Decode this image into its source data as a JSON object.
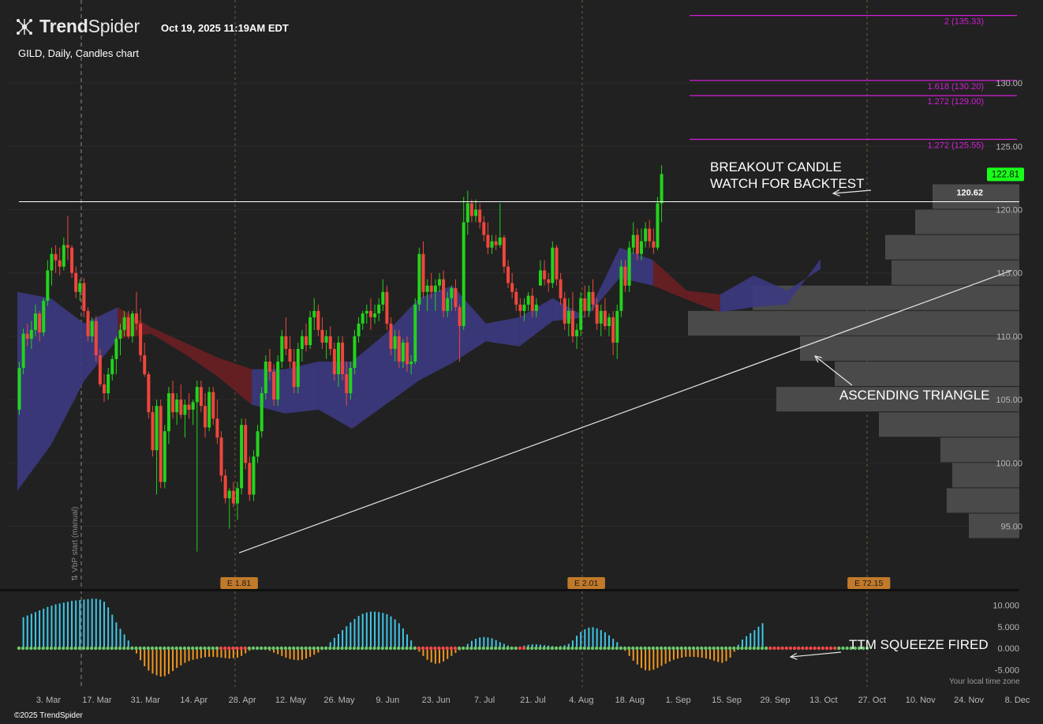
{
  "header": {
    "brand_strong": "Trend",
    "brand_light": "Spider",
    "timestamp": "Oct 19, 2025 11:19AM EDT",
    "subtitle": "GILD, Daily, Candles chart",
    "copyright": "©2025 TrendSpider",
    "timezone_label": "Your local time zone",
    "logo_icon": "trendspider-logo-icon"
  },
  "colors": {
    "background": "#212121",
    "up": "#22d41c",
    "down": "#f0463c",
    "fib": "#d21ed6",
    "cloud_bull": "#3c3a82",
    "cloud_bear": "#6b1f22",
    "vbp": "#4a4a4a",
    "squeeze_pos": "#3ec6e6",
    "squeeze_neg": "#f0961e",
    "price_tag": "#1aff1a",
    "earnings": "#c07a2a"
  },
  "chart_data": {
    "type": "candlestick",
    "symbol": "GILD",
    "timeframe": "Daily",
    "x_tick_labels": [
      "3. Mar",
      "17. Mar",
      "31. Mar",
      "14. Apr",
      "28. Apr",
      "12. May",
      "26. May",
      "9. Jun",
      "23. Jun",
      "7. Jul",
      "21. Jul",
      "4. Aug",
      "18. Aug",
      "1. Sep",
      "15. Sep",
      "29. Sep",
      "13. Oct",
      "27. Oct",
      "10. Nov",
      "24. Nov",
      "8. Dec"
    ],
    "y_axis": {
      "min": 91,
      "max": 137,
      "ticks": [
        "95.00",
        "100.00",
        "105.00",
        "110.00",
        "115.00",
        "120.00",
        "125.00",
        "130.00"
      ]
    },
    "last_price": {
      "value": 122.81,
      "label": "122.81"
    },
    "horizontal_line": {
      "value": 120.62,
      "label": "120.62"
    },
    "fib_levels": [
      {
        "value": 135.33,
        "label": "2 (135.33)"
      },
      {
        "value": 130.2,
        "label": "1.618 (130.20)"
      },
      {
        "value": 129.0,
        "label": "1.272 (129.00)"
      },
      {
        "value": 125.55,
        "label": "1.272 (125.55)"
      }
    ],
    "trendline": {
      "start": {
        "date": "2025-04-28",
        "value": 92.9
      },
      "end": {
        "date": "2025-12-11",
        "value": 115.2
      }
    },
    "earnings": [
      {
        "date": "2025-04-28",
        "label": "E 1.81"
      },
      {
        "date": "2025-08-08",
        "label": "E 2.01"
      },
      {
        "date": "2025-10-30",
        "label": "E 72.15"
      }
    ],
    "vbp_start_label": "VbP start (manual)",
    "annotations": [
      {
        "lines": [
          "BREAKOUT CANDLE",
          "WATCH FOR BACKTEST"
        ]
      },
      {
        "lines": [
          "ASCENDING TRIANGLE"
        ]
      },
      {
        "lines": [
          "TTM SQUEEZE FIRED"
        ]
      }
    ],
    "candles": [
      [
        104.2,
        108.0,
        103.8,
        107.5
      ],
      [
        107.5,
        110.6,
        107.0,
        110.2
      ],
      [
        110.2,
        111.0,
        109.2,
        109.8
      ],
      [
        109.8,
        111.2,
        109.0,
        110.5
      ],
      [
        110.5,
        112.5,
        110.0,
        111.8
      ],
      [
        111.8,
        112.0,
        109.6,
        110.3
      ],
      [
        110.3,
        113.0,
        110.0,
        112.8
      ],
      [
        112.8,
        116.0,
        112.4,
        115.2
      ],
      [
        115.2,
        117.0,
        114.0,
        116.5
      ],
      [
        116.5,
        117.2,
        115.0,
        116.0
      ],
      [
        116.0,
        117.0,
        114.8,
        115.5
      ],
      [
        115.5,
        117.8,
        115.2,
        117.2
      ],
      [
        117.2,
        119.5,
        116.0,
        117.0
      ],
      [
        117.0,
        117.2,
        114.6,
        115.0
      ],
      [
        115.0,
        115.5,
        113.0,
        113.5
      ],
      [
        113.5,
        114.5,
        112.8,
        114.2
      ],
      [
        114.2,
        114.6,
        111.5,
        112.0
      ],
      [
        112.0,
        112.3,
        109.6,
        110.0
      ],
      [
        110.0,
        111.5,
        109.5,
        111.2
      ],
      [
        111.2,
        111.6,
        108.0,
        108.5
      ],
      [
        108.5,
        109.0,
        106.0,
        106.2
      ],
      [
        106.2,
        107.0,
        104.8,
        105.5
      ],
      [
        105.5,
        107.5,
        105.0,
        107.0
      ],
      [
        107.0,
        108.5,
        106.5,
        108.2
      ],
      [
        108.2,
        110.0,
        107.0,
        109.8
      ],
      [
        109.8,
        111.0,
        108.5,
        110.5
      ],
      [
        110.5,
        112.0,
        110.0,
        111.5
      ],
      [
        111.5,
        112.0,
        109.8,
        110.0
      ],
      [
        110.0,
        112.0,
        109.5,
        111.8
      ],
      [
        111.8,
        113.5,
        110.5,
        111.0
      ],
      [
        111.0,
        112.2,
        108.0,
        108.5
      ],
      [
        108.5,
        109.5,
        106.8,
        107.0
      ],
      [
        107.0,
        107.2,
        103.5,
        104.0
      ],
      [
        104.0,
        104.5,
        100.5,
        101.0
      ],
      [
        101.0,
        105.0,
        97.5,
        104.5
      ],
      [
        104.5,
        105.0,
        98.0,
        98.5
      ],
      [
        98.5,
        103.0,
        98.0,
        102.5
      ],
      [
        102.5,
        106.0,
        101.5,
        105.5
      ],
      [
        105.5,
        106.5,
        103.5,
        104.0
      ],
      [
        104.0,
        105.5,
        103.0,
        105.0
      ],
      [
        105.0,
        106.2,
        103.5,
        103.8
      ],
      [
        103.8,
        105.0,
        102.0,
        104.6
      ],
      [
        104.6,
        105.5,
        103.5,
        104.2
      ],
      [
        104.2,
        105.0,
        103.0,
        104.8
      ],
      [
        104.8,
        106.5,
        93.0,
        106.0
      ],
      [
        106.0,
        106.5,
        104.0,
        104.5
      ],
      [
        104.5,
        105.5,
        102.0,
        102.8
      ],
      [
        102.8,
        106.0,
        102.5,
        105.6
      ],
      [
        105.6,
        106.0,
        103.0,
        103.5
      ],
      [
        103.5,
        105.0,
        101.5,
        102.0
      ],
      [
        102.0,
        102.5,
        98.5,
        99.0
      ],
      [
        99.0,
        99.5,
        96.8,
        97.2
      ],
      [
        97.2,
        98.0,
        94.8,
        97.8
      ],
      [
        97.8,
        98.5,
        96.5,
        96.8
      ],
      [
        96.8,
        98.5,
        95.5,
        98.0
      ],
      [
        98.0,
        103.5,
        97.5,
        103.0
      ],
      [
        103.0,
        103.5,
        99.5,
        100.0
      ],
      [
        100.0,
        100.5,
        97.0,
        97.5
      ],
      [
        97.5,
        101.0,
        97.0,
        100.5
      ],
      [
        100.5,
        103.0,
        100.0,
        102.5
      ],
      [
        102.5,
        106.0,
        102.0,
        105.5
      ],
      [
        105.5,
        108.5,
        105.0,
        108.0
      ],
      [
        108.0,
        109.0,
        106.5,
        107.2
      ],
      [
        107.2,
        107.8,
        104.5,
        105.0
      ],
      [
        105.0,
        108.5,
        104.5,
        108.0
      ],
      [
        108.0,
        110.5,
        107.5,
        110.0
      ],
      [
        110.0,
        111.5,
        108.5,
        109.0
      ],
      [
        109.0,
        110.0,
        107.5,
        108.0
      ],
      [
        108.0,
        109.0,
        105.5,
        106.0
      ],
      [
        106.0,
        109.5,
        105.5,
        109.0
      ],
      [
        109.0,
        110.5,
        108.0,
        110.0
      ],
      [
        110.0,
        111.0,
        108.8,
        109.3
      ],
      [
        109.3,
        112.0,
        109.0,
        111.5
      ],
      [
        111.5,
        113.0,
        110.5,
        112.0
      ],
      [
        112.0,
        112.5,
        110.0,
        110.5
      ],
      [
        110.5,
        111.5,
        109.0,
        109.5
      ],
      [
        109.5,
        110.5,
        108.2,
        110.0
      ],
      [
        110.0,
        110.8,
        108.5,
        109.0
      ],
      [
        109.0,
        109.5,
        106.5,
        107.0
      ],
      [
        107.0,
        110.0,
        106.0,
        109.5
      ],
      [
        109.5,
        110.0,
        106.5,
        107.0
      ],
      [
        107.0,
        108.0,
        104.5,
        105.5
      ],
      [
        105.5,
        108.0,
        105.0,
        107.5
      ],
      [
        107.5,
        110.5,
        107.0,
        110.0
      ],
      [
        110.0,
        111.5,
        109.5,
        111.0
      ],
      [
        111.0,
        112.0,
        110.5,
        111.8
      ],
      [
        111.8,
        112.5,
        111.0,
        112.0
      ],
      [
        112.0,
        113.0,
        110.5,
        111.5
      ],
      [
        111.5,
        112.5,
        111.0,
        111.8
      ],
      [
        111.8,
        113.0,
        111.2,
        112.5
      ],
      [
        112.5,
        114.5,
        112.0,
        113.5
      ],
      [
        113.5,
        114.0,
        110.5,
        111.0
      ],
      [
        111.0,
        111.5,
        108.5,
        109.0
      ],
      [
        109.0,
        110.5,
        108.0,
        110.0
      ],
      [
        110.0,
        110.5,
        107.5,
        108.0
      ],
      [
        108.0,
        109.8,
        107.5,
        109.5
      ],
      [
        109.5,
        110.0,
        107.2,
        107.8
      ],
      [
        107.8,
        108.5,
        107.0,
        108.0
      ],
      [
        108.0,
        113.0,
        107.8,
        112.5
      ],
      [
        112.5,
        117.0,
        112.0,
        116.5
      ],
      [
        116.5,
        117.5,
        113.0,
        113.5
      ],
      [
        113.5,
        114.5,
        112.0,
        114.0
      ],
      [
        114.0,
        115.0,
        113.0,
        113.5
      ],
      [
        113.5,
        114.5,
        112.0,
        114.0
      ],
      [
        114.0,
        115.0,
        113.5,
        114.5
      ],
      [
        114.5,
        115.2,
        111.5,
        112.0
      ],
      [
        112.0,
        113.5,
        111.5,
        113.0
      ],
      [
        113.0,
        114.0,
        112.0,
        113.8
      ],
      [
        113.8,
        114.5,
        112.0,
        112.3
      ],
      [
        112.3,
        112.5,
        108.0,
        110.8
      ],
      [
        110.8,
        121.0,
        110.5,
        119.0
      ],
      [
        119.0,
        121.5,
        118.0,
        120.5
      ],
      [
        120.5,
        120.8,
        119.0,
        119.5
      ],
      [
        119.5,
        120.8,
        119.0,
        120.0
      ],
      [
        120.0,
        120.5,
        118.5,
        119.0
      ],
      [
        119.0,
        119.5,
        117.5,
        118.0
      ],
      [
        118.0,
        119.0,
        116.5,
        117.0
      ],
      [
        117.0,
        118.0,
        116.5,
        117.5
      ],
      [
        117.5,
        118.0,
        116.8,
        117.2
      ],
      [
        117.2,
        120.5,
        117.0,
        117.8
      ],
      [
        117.8,
        118.0,
        115.0,
        115.5
      ],
      [
        115.5,
        116.0,
        113.8,
        114.2
      ],
      [
        114.2,
        115.0,
        113.0,
        113.5
      ],
      [
        113.5,
        113.8,
        112.0,
        112.5
      ],
      [
        112.5,
        113.0,
        111.5,
        112.0
      ],
      [
        112.0,
        113.0,
        111.2,
        112.5
      ],
      [
        112.5,
        113.5,
        112.0,
        113.2
      ],
      [
        113.2,
        113.8,
        111.5,
        112.0
      ],
      [
        112.0,
        113.0,
        111.5,
        112.5
      ],
      [
        114.0,
        116.0,
        114.0,
        115.2
      ],
      [
        115.2,
        116.0,
        114.0,
        114.5
      ],
      [
        114.5,
        115.0,
        113.5,
        114.2
      ],
      [
        114.2,
        117.5,
        113.8,
        117.0
      ],
      [
        117.0,
        117.2,
        114.0,
        114.5
      ],
      [
        114.5,
        115.0,
        112.5,
        113.0
      ],
      [
        113.0,
        113.5,
        110.5,
        111.0
      ],
      [
        111.0,
        113.0,
        110.0,
        112.0
      ],
      [
        112.0,
        113.5,
        109.5,
        110.0
      ],
      [
        110.0,
        111.0,
        109.0,
        110.5
      ],
      [
        110.5,
        113.5,
        110.0,
        113.0
      ],
      [
        113.0,
        114.0,
        111.5,
        112.0
      ],
      [
        112.0,
        114.0,
        111.5,
        113.5
      ],
      [
        113.5,
        114.5,
        112.0,
        112.5
      ],
      [
        112.5,
        113.0,
        110.5,
        111.0
      ],
      [
        111.0,
        112.5,
        110.0,
        112.0
      ],
      [
        112.0,
        113.0,
        110.5,
        110.8
      ],
      [
        110.8,
        111.8,
        110.0,
        111.5
      ],
      [
        111.5,
        112.0,
        108.5,
        109.5
      ],
      [
        109.5,
        112.5,
        108.2,
        112.0
      ],
      [
        112.0,
        116.0,
        111.5,
        115.5
      ],
      [
        115.5,
        116.0,
        113.5,
        114.0
      ],
      [
        114.0,
        117.5,
        113.5,
        117.0
      ],
      [
        117.0,
        119.0,
        116.5,
        118.0
      ],
      [
        118.0,
        118.5,
        116.0,
        116.5
      ],
      [
        116.5,
        118.5,
        116.0,
        117.5
      ],
      [
        117.5,
        119.0,
        117.0,
        118.5
      ],
      [
        118.5,
        119.2,
        117.0,
        117.5
      ],
      [
        117.5,
        118.5,
        116.5,
        117.0
      ],
      [
        117.0,
        121.0,
        116.8,
        120.5
      ],
      [
        120.5,
        123.5,
        119.0,
        122.81
      ]
    ],
    "ribbon_upper": [
      113.5,
      113.0,
      111.0,
      112.3,
      110.7,
      109.5,
      108.3,
      107.4,
      107.4,
      108.0,
      108.0,
      110.2,
      113.0,
      114.0,
      111.0,
      111.5,
      113.0,
      111.5,
      117.0,
      116.0,
      113.6,
      113.3,
      114.8,
      113.6,
      115.3
    ],
    "ribbon_lower": [
      97.8,
      101.4,
      106.5,
      109.8,
      110.2,
      108.6,
      106.8,
      104.6,
      103.9,
      104.2,
      102.7,
      104.6,
      106.5,
      107.9,
      109.6,
      109.2,
      111.2,
      111.5,
      114.6,
      114.0,
      112.9,
      111.9,
      112.3,
      112.5,
      116.1
    ],
    "squeeze_histogram": [
      7.2,
      7.6,
      8.0,
      8.4,
      8.8,
      9.2,
      9.6,
      9.9,
      10.2,
      10.4,
      10.6,
      10.8,
      11.0,
      11.1,
      11.2,
      11.3,
      11.4,
      11.5,
      11.5,
      11.3,
      10.8,
      9.5,
      7.8,
      6.0,
      4.5,
      3.2,
      1.8,
      0.4,
      -1.2,
      -2.8,
      -4.2,
      -5.2,
      -5.9,
      -6.3,
      -6.6,
      -6.5,
      -6.0,
      -5.3,
      -4.6,
      -4.0,
      -3.4,
      -3.0,
      -2.7,
      -2.5,
      -2.3,
      -2.1,
      -2.0,
      -2.0,
      -2.1,
      -2.2,
      -2.3,
      -2.4,
      -2.3,
      -2.2,
      -1.8,
      -1.2,
      -0.6,
      -0.2,
      0.1,
      -0.1,
      -0.3,
      -0.6,
      -1.0,
      -1.4,
      -1.8,
      -2.2,
      -2.5,
      -2.7,
      -2.8,
      -2.7,
      -2.4,
      -2.0,
      -1.5,
      -1.0,
      -0.4,
      0.4,
      1.4,
      2.4,
      3.3,
      4.2,
      5.1,
      6.0,
      6.8,
      7.5,
      8.0,
      8.3,
      8.5,
      8.5,
      8.4,
      8.2,
      7.9,
      7.4,
      6.7,
      5.8,
      4.6,
      3.2,
      1.8,
      0.4,
      -0.8,
      -1.8,
      -2.7,
      -3.3,
      -3.6,
      -3.5,
      -3.1,
      -2.5,
      -1.8,
      -1.1,
      -0.5,
      0.2,
      1.0,
      1.7,
      2.2,
      2.5,
      2.6,
      2.5,
      2.3,
      1.9,
      1.4,
      1.0,
      0.6,
      0.3,
      0.2,
      0.4,
      0.6,
      0.8,
      0.9,
      0.9,
      0.8,
      0.7,
      0.6,
      0.5,
      0.4,
      0.5,
      0.7,
      1.0,
      1.8,
      2.9,
      3.8,
      4.4,
      4.8,
      4.9,
      4.6,
      4.2,
      3.7,
      3.0,
      2.2,
      1.4,
      0.4,
      -0.6,
      -1.8,
      -2.9,
      -3.8,
      -4.6,
      -5.1,
      -5.2,
      -5.0,
      -4.6,
      -4.1,
      -3.6,
      -3.1,
      -2.7,
      -2.4,
      -2.2,
      -2.0,
      -2.0,
      -2.0,
      -2.1,
      -2.2,
      -2.4,
      -2.6,
      -2.9,
      -3.2,
      -3.4,
      -3.0,
      -2.2,
      -0.8,
      0.8,
      2.0,
      2.8,
      3.5,
      4.2,
      5.0,
      5.8
    ],
    "squeeze_dots": "ggggggggggggggggggggggggggggggggggggggggggggggggggrrrrrrrggggggggggggggggggggggggggggggggggggggggggrrrrrrrrrrgggggggggggggggrrggggggggggggggggggggggggggggggggggggggggggggggggggggggggggggrrrrrrrrrrrrrrrrrgggggggg",
    "squeeze_y_ticks": [
      "10.000",
      "5.000",
      "0.000",
      "-5.000"
    ],
    "squeeze_y_range": [
      -8,
      13
    ],
    "vbp_bins": [
      {
        "price": 121.0,
        "volume": 110
      },
      {
        "price": 119.0,
        "volume": 132
      },
      {
        "price": 117.0,
        "volume": 170
      },
      {
        "price": 115.0,
        "volume": 162
      },
      {
        "price": 113.0,
        "volume": 338
      },
      {
        "price": 111.0,
        "volume": 420
      },
      {
        "price": 109.0,
        "volume": 278
      },
      {
        "price": 107.0,
        "volume": 234
      },
      {
        "price": 105.0,
        "volume": 308
      },
      {
        "price": 103.0,
        "volume": 178
      },
      {
        "price": 101.0,
        "volume": 100
      },
      {
        "price": 99.0,
        "volume": 85
      },
      {
        "price": 97.0,
        "volume": 92
      },
      {
        "price": 95.0,
        "volume": 64
      }
    ]
  }
}
